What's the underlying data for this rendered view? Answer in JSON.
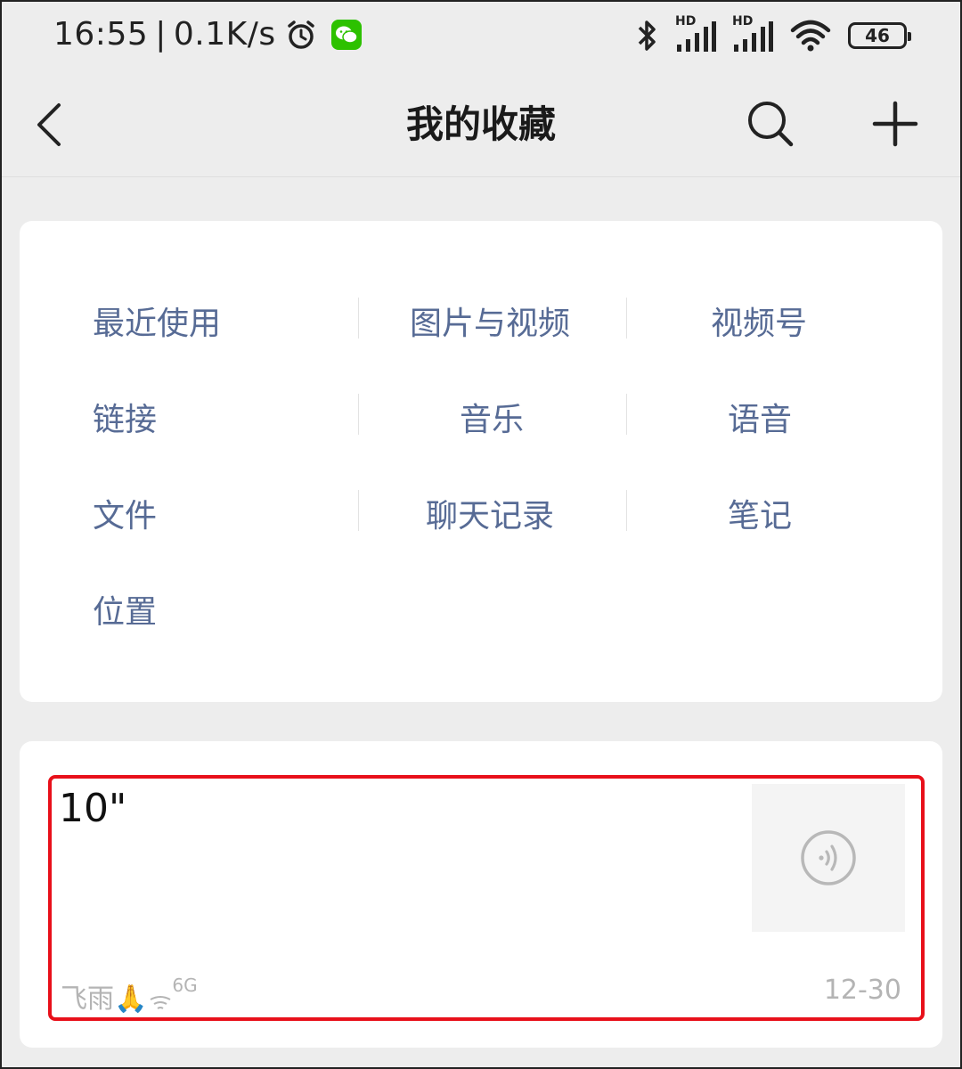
{
  "status_bar": {
    "time": "16:55",
    "separator": "|",
    "speed": "0.1K/s",
    "hd_label_1": "HD",
    "hd_label_2": "HD",
    "battery": "46"
  },
  "nav": {
    "title": "我的收藏"
  },
  "categories": [
    {
      "label": "最近使用"
    },
    {
      "label": "图片与视频"
    },
    {
      "label": "视频号"
    },
    {
      "label": "链接"
    },
    {
      "label": "音乐"
    },
    {
      "label": "语音"
    },
    {
      "label": "文件"
    },
    {
      "label": "聊天记录"
    },
    {
      "label": "笔记"
    },
    {
      "label": "位置"
    }
  ],
  "favorites": [
    {
      "duration": "10\"",
      "source": "飞雨🙏",
      "source_suffix": "6G",
      "date": "12-30",
      "thumb_icon": "voice-icon"
    }
  ],
  "colors": {
    "link": "#576b95",
    "highlight": "#e8101a",
    "wechat": "#2dc100"
  }
}
